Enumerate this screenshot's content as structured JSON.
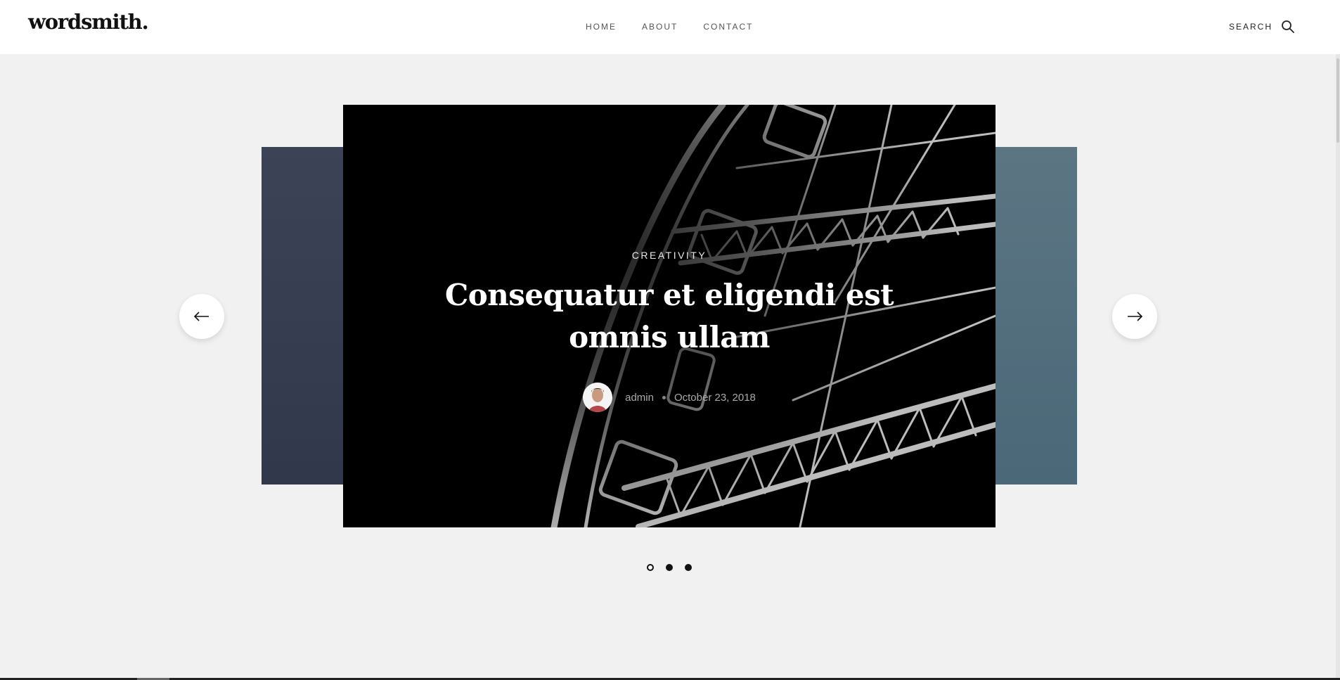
{
  "header": {
    "logo": "wordsmith.",
    "nav": [
      {
        "label": "HOME"
      },
      {
        "label": "ABOUT"
      },
      {
        "label": "CONTACT"
      }
    ],
    "search_label": "SEARCH",
    "search_icon": "search-icon"
  },
  "slider": {
    "active_slide": {
      "category": "CREATIVITY",
      "title": "Consequatur et eligendi est omnis ullam",
      "author": "admin",
      "date": "October 23, 2018",
      "avatar_icon": "author-avatar"
    },
    "prev_icon": "arrow-left-icon",
    "next_icon": "arrow-right-icon",
    "dots_count": 3,
    "active_dot": 1,
    "colors": {
      "left_slide": "#373d51",
      "right_slide": "#52707f",
      "main_slide_bg": "#000000"
    }
  }
}
